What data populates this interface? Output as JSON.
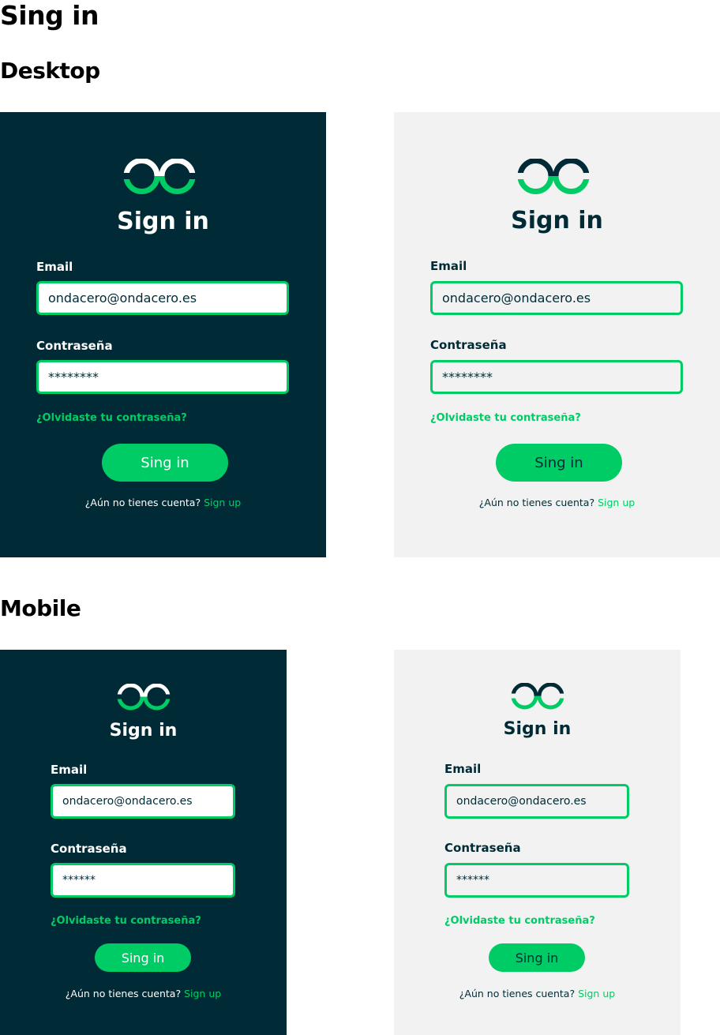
{
  "page": {
    "title": "Sing in",
    "desktop_heading": "Desktop",
    "mobile_heading": "Mobile"
  },
  "colors": {
    "dark_bg": "#002b36",
    "light_bg": "#f2f2f2",
    "accent": "#00cc66",
    "white": "#ffffff"
  },
  "icons": {
    "logo": "ondacero-logo-icon"
  },
  "form": {
    "title": "Sign in",
    "email_label": "Email",
    "email_value": "ondacero@ondacero.es",
    "password_label": "Contraseña",
    "password_value_desktop": "********",
    "password_value_mobile": "******",
    "forgot_link": "¿Olvidaste tu contraseña?",
    "submit_label": "Sing in",
    "no_account_text": "¿Aún no tienes cuenta?",
    "signup_link": "Sign up"
  }
}
